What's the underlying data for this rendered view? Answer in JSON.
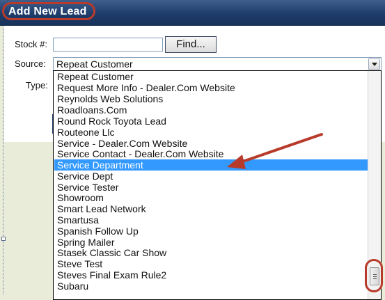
{
  "window": {
    "title": "Add New Lead"
  },
  "form": {
    "stock_label": "Stock #:",
    "stock_value": "",
    "find_label": "Find...",
    "source_label": "Source:",
    "source_value": "Repeat Customer",
    "type_label": "Type:"
  },
  "dropdown": {
    "options": [
      "Repeat Customer",
      "Request More Info - Dealer.Com Website",
      "Reynolds Web Solutions",
      "Roadloans.Com",
      "Round Rock Toyota Lead",
      "Routeone Llc",
      "Service - Dealer.Com Website",
      "Service Contact - Dealer.Com Website",
      "Service Department",
      "Service Dept",
      "Service Tester",
      "Showroom",
      "Smart Lead Network",
      "Smartusa",
      "Spanish Follow Up",
      "Spring Mailer",
      "Stasek Classic Car Show",
      "Steve Test",
      "Steves Final Exam Rule2",
      "Subaru"
    ],
    "highlighted_index": 8
  },
  "annotations": {
    "color": "#b83a2a"
  },
  "colors": {
    "titlebar": "#1f3d6b",
    "selection": "#3399ff"
  }
}
